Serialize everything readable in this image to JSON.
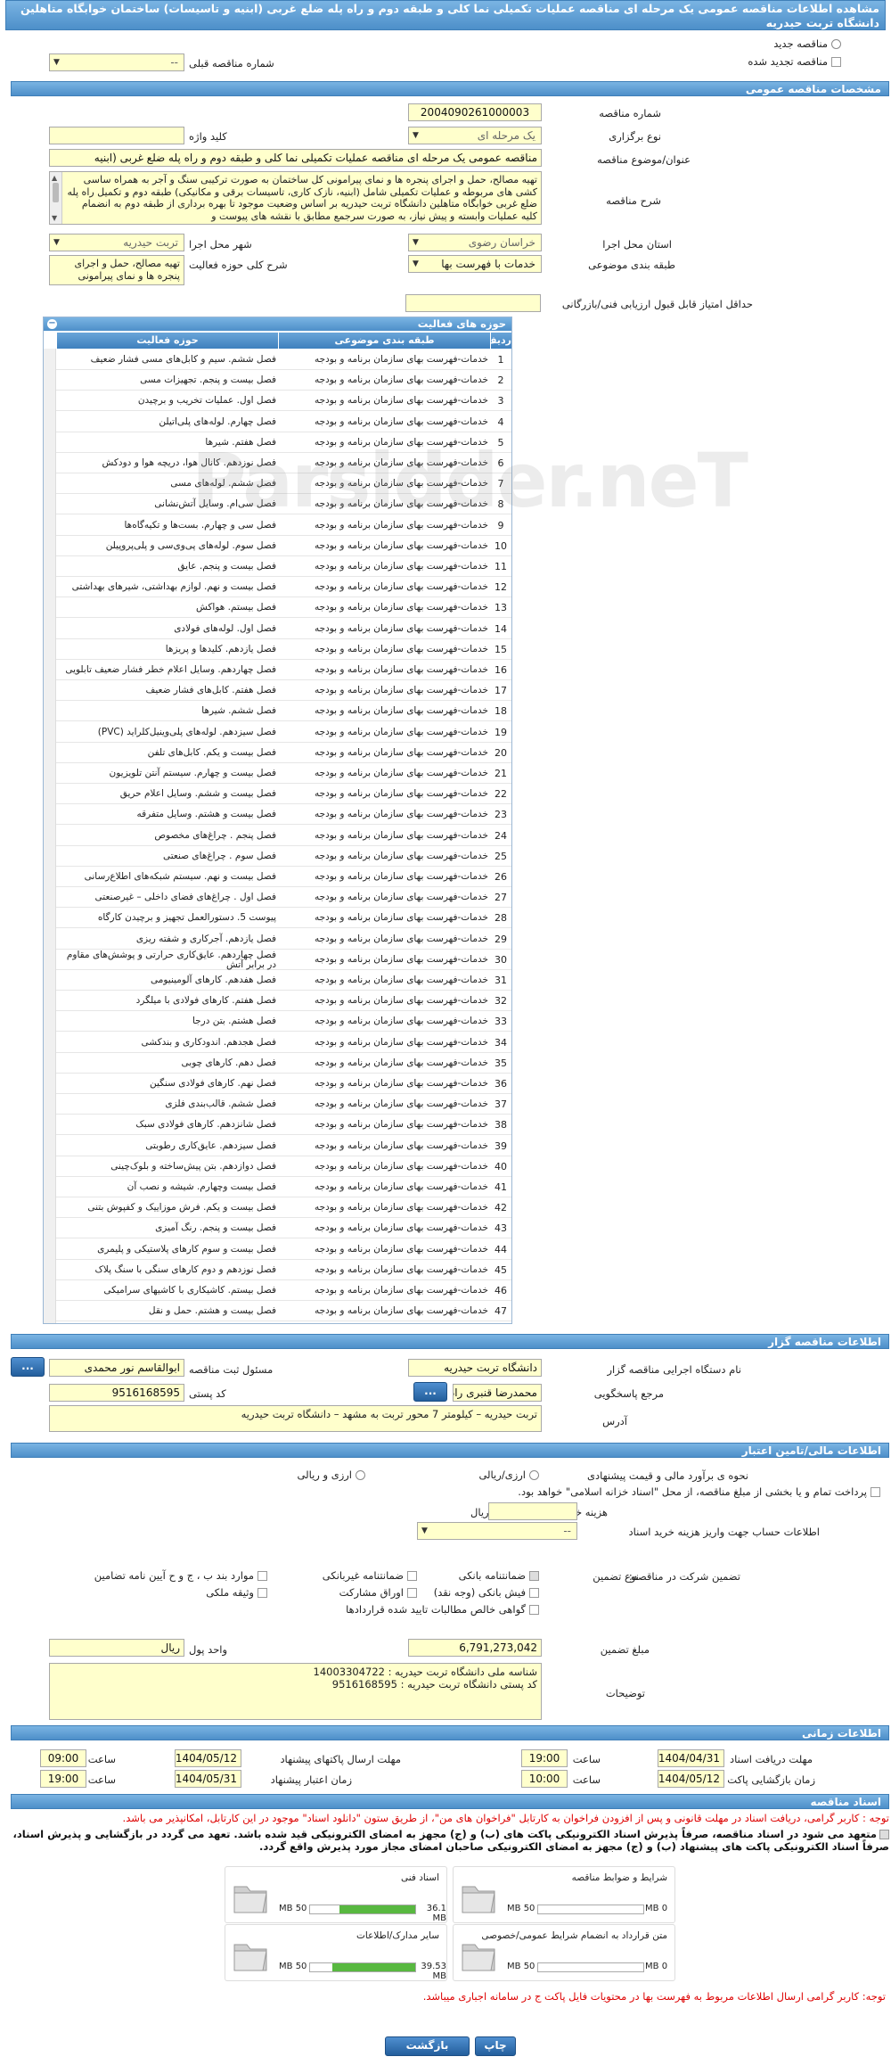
{
  "page_title": "مشاهده اطلاعات مناقصه عمومی یک مرحله ای مناقصه عملیات تکمیلی نما کلی و طبقه دوم و راه پله ضلع غربی (ابنیه و تاسیسات) ساختمان خوابگاه متاهلین دانشگاه تربت حیدریه",
  "top": {
    "new_tender": "مناقصه جدید",
    "renewed_tender": "مناقصه تجدید شده",
    "prev_tender_label": "شماره مناقصه قبلی",
    "prev_tender_value": "--"
  },
  "general": {
    "section_title": "مشخصات مناقصه عمومی",
    "tender_number_label": "شماره مناقصه",
    "tender_number": "2004090261000003",
    "type_label": "نوع برگزاری",
    "type_value": "یک مرحله ای",
    "keyword_label": "کلید واژه",
    "keyword_value": "",
    "subject_label": "عنوان/موضوع مناقصه",
    "subject_value": "مناقصه عمومی یک مرحله ای مناقصه عملیات تکمیلی نما کلی و طبقه دوم و راه پله ضلع غربی (ابنیه",
    "desc_label": "شرح مناقصه",
    "desc_value": "تهیه مصالح، حمل و اجرای پنجره ها و نمای پیرامونی کل ساختمان به صورت ترکیبی سنگ و آجر به همراه ساسی کشی های مربوطه و عملیات تکمیلی شامل (ابنیه، نازک کاری، تاسیسات برقی و مکانیکی) طبقه دوم و تکمیل راه پله ضلع غربی خوابگاه متاهلین دانشگاه تربت حیدریه بر اساس وضعیت موجود تا بهره برداری از طبقه دوم به انضمام کلیه عملیات وابسته و پیش نیاز، به صورت سرجمع مطابق با نقشه های پیوست و",
    "province_label": "استان محل اجرا",
    "province_value": "خراسان رضوی",
    "city_label": "شهر محل اجرا",
    "city_value": "تربت حیدریه",
    "category_label": "طبقه بندی موضوعی",
    "category_value": "خدمات با فهرست بها",
    "activity_desc_label": "شرح کلی حوزه فعالیت",
    "activity_desc_value": "تهیه مصالح، حمل و اجرای پنجره ها و نمای پیرامونی",
    "min_score_label": "حداقل امتیاز قابل قبول ارزیابی فنی/بازرگانی",
    "min_score_value": ""
  },
  "activities": {
    "title": "حوزه های فعالیت",
    "col_row": "ردیف",
    "col_category": "طبقه بندی موضوعی",
    "col_field": "حوزه فعالیت",
    "rows": [
      {
        "n": "1",
        "cat": "خدمات-فهرست بهای سازمان برنامه و بودجه",
        "field": "فصل ششم. سیم و کابل‌های مسی فشار ضعیف"
      },
      {
        "n": "2",
        "cat": "خدمات-فهرست بهای سازمان برنامه و بودجه",
        "field": "فصل بیست و پنجم. تجهیزات مسی"
      },
      {
        "n": "3",
        "cat": "خدمات-فهرست بهای سازمان برنامه و بودجه",
        "field": "فصل اول. عملیات تخریب و برچیدن"
      },
      {
        "n": "4",
        "cat": "خدمات-فهرست بهای سازمان برنامه و بودجه",
        "field": "فصل چهارم. لوله‌های پلی‌اتیلن"
      },
      {
        "n": "5",
        "cat": "خدمات-فهرست بهای سازمان برنامه و بودجه",
        "field": "فصل هفتم. شیرها"
      },
      {
        "n": "6",
        "cat": "خدمات-فهرست بهای سازمان برنامه و بودجه",
        "field": "فصل نوزدهم. کانال هوا، دریچه هوا و دودکش"
      },
      {
        "n": "7",
        "cat": "خدمات-فهرست بهای سازمان برنامه و بودجه",
        "field": "فصل ششم. لوله‌های مسی"
      },
      {
        "n": "8",
        "cat": "خدمات-فهرست بهای سازمان برنامه و بودجه",
        "field": "فصل سی‌ام. وسایل آتش‌نشانی"
      },
      {
        "n": "9",
        "cat": "خدمات-فهرست بهای سازمان برنامه و بودجه",
        "field": "فصل سی و چهارم. بست‌ها و تکیه‌گاه‌ها"
      },
      {
        "n": "10",
        "cat": "خدمات-فهرست بهای سازمان برنامه و بودجه",
        "field": "فصل سوم. لوله‌های پی‌وی‌سی و پلی‌پروپیلن"
      },
      {
        "n": "11",
        "cat": "خدمات-فهرست بهای سازمان برنامه و بودجه",
        "field": "فصل بیست و پنجم. عایق"
      },
      {
        "n": "12",
        "cat": "خدمات-فهرست بهای سازمان برنامه و بودجه",
        "field": "فصل بیست و نهم. لوازم بهداشتی، شیرهای بهداشتی"
      },
      {
        "n": "13",
        "cat": "خدمات-فهرست بهای سازمان برنامه و بودجه",
        "field": "فصل بیستم. هواکش"
      },
      {
        "n": "14",
        "cat": "خدمات-فهرست بهای سازمان برنامه و بودجه",
        "field": "فصل اول. لوله‌های فولادی"
      },
      {
        "n": "15",
        "cat": "خدمات-فهرست بهای سازمان برنامه و بودجه",
        "field": "فصل یازدهم. کلیدها و پریزها"
      },
      {
        "n": "16",
        "cat": "خدمات-فهرست بهای سازمان برنامه و بودجه",
        "field": "فصل چهاردهم. وسایل اعلام خطر فشار ضعیف تابلویی"
      },
      {
        "n": "17",
        "cat": "خدمات-فهرست بهای سازمان برنامه و بودجه",
        "field": "فصل هفتم. کابل‌های فشار ضعیف"
      },
      {
        "n": "18",
        "cat": "خدمات-فهرست بهای سازمان برنامه و بودجه",
        "field": "فصل ششم. شیرها"
      },
      {
        "n": "19",
        "cat": "خدمات-فهرست بهای سازمان برنامه و بودجه",
        "field": "فصل سیزدهم. لوله‌های پلی‌وینیل‌کلراید (PVC)"
      },
      {
        "n": "20",
        "cat": "خدمات-فهرست بهای سازمان برنامه و بودجه",
        "field": "فصل بیست و یکم. کابل‌های تلفن"
      },
      {
        "n": "21",
        "cat": "خدمات-فهرست بهای سازمان برنامه و بودجه",
        "field": "فصل بیست و چهارم. سیستم آنتن تلویزیون"
      },
      {
        "n": "22",
        "cat": "خدمات-فهرست بهای سازمان برنامه و بودجه",
        "field": "فصل بیست و ششم. وسایل اعلام حریق"
      },
      {
        "n": "23",
        "cat": "خدمات-فهرست بهای سازمان برنامه و بودجه",
        "field": "فصل بیست و هشتم. وسایل متفرقه"
      },
      {
        "n": "24",
        "cat": "خدمات-فهرست بهای سازمان برنامه و بودجه",
        "field": "فصل پنجم . چراغ‌های مخصوص"
      },
      {
        "n": "25",
        "cat": "خدمات-فهرست بهای سازمان برنامه و بودجه",
        "field": "فصل سوم . چراغ‌های صنعتی"
      },
      {
        "n": "26",
        "cat": "خدمات-فهرست بهای سازمان برنامه و بودجه",
        "field": "فصل بیست و نهم. سیستم شبکه‌های اطلاع‌رسانی"
      },
      {
        "n": "27",
        "cat": "خدمات-فهرست بهای سازمان برنامه و بودجه",
        "field": "فصل اول . چراغ‌های فضای داخلی – غیرصنعتی"
      },
      {
        "n": "28",
        "cat": "خدمات-فهرست بهای سازمان برنامه و بودجه",
        "field": "پیوست 5. دستورالعمل تجهیز و برچیدن کارگاه"
      },
      {
        "n": "29",
        "cat": "خدمات-فهرست بهای سازمان برنامه و بودجه",
        "field": "فصل یازدهم. آجرکاری و شفته ریزی"
      },
      {
        "n": "30",
        "cat": "خدمات-فهرست بهای سازمان برنامه و بودجه",
        "field": "فصل چهاردهم. عایق‌کاری حرارتی و پوشش‌های مقاوم در برابر آتش",
        "two": true
      },
      {
        "n": "31",
        "cat": "خدمات-فهرست بهای سازمان برنامه و بودجه",
        "field": "فصل هفدهم. کارهای آلومینیومی"
      },
      {
        "n": "32",
        "cat": "خدمات-فهرست بهای سازمان برنامه و بودجه",
        "field": "فصل هفتم. کارهای فولادی با میلگرد"
      },
      {
        "n": "33",
        "cat": "خدمات-فهرست بهای سازمان برنامه و بودجه",
        "field": "فصل هشتم. بتن درجا"
      },
      {
        "n": "34",
        "cat": "خدمات-فهرست بهای سازمان برنامه و بودجه",
        "field": "فصل هجدهم. اندودکاری و بندکشی"
      },
      {
        "n": "35",
        "cat": "خدمات-فهرست بهای سازمان برنامه و بودجه",
        "field": "فصل دهم. کارهای چوبی"
      },
      {
        "n": "36",
        "cat": "خدمات-فهرست بهای سازمان برنامه و بودجه",
        "field": "فصل نهم. کارهای فولادی سنگین"
      },
      {
        "n": "37",
        "cat": "خدمات-فهرست بهای سازمان برنامه و بودجه",
        "field": "فصل ششم. قالب‌بندی فلزی"
      },
      {
        "n": "38",
        "cat": "خدمات-فهرست بهای سازمان برنامه و بودجه",
        "field": "فصل شانزدهم. کارهای فولادی سبک"
      },
      {
        "n": "39",
        "cat": "خدمات-فهرست بهای سازمان برنامه و بودجه",
        "field": "فصل سیزدهم. عایق‌کاری رطوبتی"
      },
      {
        "n": "40",
        "cat": "خدمات-فهرست بهای سازمان برنامه و بودجه",
        "field": "فصل دوازدهم. بتن پیش‌ساخته و بلوک‌چینی"
      },
      {
        "n": "41",
        "cat": "خدمات-فهرست بهای سازمان برنامه و بودجه",
        "field": "فصل بیست وچهارم. شیشه و نصب آن"
      },
      {
        "n": "42",
        "cat": "خدمات-فهرست بهای سازمان برنامه و بودجه",
        "field": "فصل بیست و یکم. فرش موزاییک و کفپوش بتنی"
      },
      {
        "n": "43",
        "cat": "خدمات-فهرست بهای سازمان برنامه و بودجه",
        "field": "فصل بیست و پنجم. رنگ آمیزی"
      },
      {
        "n": "44",
        "cat": "خدمات-فهرست بهای سازمان برنامه و بودجه",
        "field": "فصل بیست و سوم کارهای پلاستیکی و پلیمری"
      },
      {
        "n": "45",
        "cat": "خدمات-فهرست بهای سازمان برنامه و بودجه",
        "field": "فصل نوزدهم و دوم کارهای سنگی با سنگ پلاک"
      },
      {
        "n": "46",
        "cat": "خدمات-فهرست بهای سازمان برنامه و بودجه",
        "field": "فصل بیستم. کاشیکاری با کاشیهای سرامیکی"
      },
      {
        "n": "47",
        "cat": "خدمات-فهرست بهای سازمان برنامه و بودجه",
        "field": "فصل بیست و هشتم. حمل و نقل"
      }
    ]
  },
  "organizer": {
    "section_title": "اطلاعات مناقصه گزار",
    "org_label": "نام دستگاه اجرایی مناقصه گزار",
    "org_value": "دانشگاه تربت حیدریه",
    "resp_label": "مسئول ثبت مناقصه",
    "resp_value": "ابوالقاسم نور محمدی",
    "answer_label": "مرجع پاسخگویی",
    "answer_value": "محمدرضا قنبری راد",
    "postal_label": "کد پستی",
    "postal_value": "9516168595",
    "address_label": "آدرس",
    "address_value": "تربت حیدریه – کیلومتر 7 محور تربت به مشهد – دانشگاه تربت حیدریه",
    "dots": "..."
  },
  "finance": {
    "section_title": "اطلاعات مالی/تامین اعتبار",
    "estimate_label": "نحوه ی برآورد مالی و قیمت پیشنهادی",
    "opt_rial": "ارزی/ریالی",
    "opt_fx": "ارزی و ریالی",
    "treasury_note": "پرداخت تمام و یا بخشی از مبلغ مناقصه، از محل \"اسناد خزانه اسلامی\" خواهد بود.",
    "doc_fee_label": "هزینه خرید اسناد",
    "doc_fee_value": "",
    "doc_fee_unit": "ریال",
    "account_label": "اطلاعات حساب جهت واریز هزینه خرید اسناد",
    "account_value": "--",
    "guarantee_label": "تضمین شرکت در مناقصه:",
    "guarantee_type_label": "نوع تضمین",
    "g1": "ضمانتنامه بانکی",
    "g2": "ضمانتنامه غیربانکی",
    "g3": "موارد بند ب ، ج و ح آیین نامه تضامین",
    "g4": "فیش بانکی (وجه نقد)",
    "g5": "اوراق مشارکت",
    "g6": "وثیقه ملکی",
    "g7": "گواهی خالص مطالبات تایید شده قراردادها",
    "amount_label": "مبلغ تضمین",
    "amount_value": "6,791,273,042",
    "currency_label": "واحد پول",
    "currency_value": "ریال",
    "notes_label": "توضیحات",
    "notes_line1": "شناسه ملی دانشگاه تربت حیدریه : 14003304722",
    "notes_line2": "کد پستی دانشگاه تربت حیدریه : 9516168595"
  },
  "timing": {
    "section_title": "اطلاعات زمانی",
    "receive_label": "مهلت دریافت اسناد",
    "receive_date": "1404/04/31",
    "receive_time": "19:00",
    "send_label": "مهلت ارسال پاکتهای پیشنهاد",
    "send_date": "1404/05/12",
    "send_time": "09:00",
    "open_label": "زمان بازگشایی پاکت ها",
    "open_date": "1404/05/12",
    "open_time": "10:00",
    "valid_label": "زمان اعتبار پیشنهاد",
    "valid_date": "1404/05/31",
    "valid_time": "19:00",
    "time_label": "ساعت"
  },
  "docs": {
    "section_title": "اسناد مناقصه",
    "note1": "توجه : کاربر گرامی، دریافت اسناد در مهلت قانونی و پس از افزودن فراخوان به کارتابل \"فراخوان های من\"، از طریق ستون \"دانلود اسناد\" موجود در این کارتابل، امکانپذیر می باشد.",
    "commit": "متعهد می شود در اسناد مناقصه، صرفاً پذیرش اسناد الکترونیکی پاکت های (ب) و (ج) مجهز به امضای الکترونیکی قید شده باشد. تعهد می گردد در بازگشایی و پذیرش اسناد، صرفاً اسناد الکترونیکی پاکت های پیشنهاد (ب) و (ج) مجهز به امضای الکترونیکی صاحبان امضای مجاز مورد پذیرش واقع گردد.",
    "items": [
      {
        "title": "شرایط و ضوابط مناقصه",
        "cur": "0 MB",
        "max": "50 MB",
        "pct": 0
      },
      {
        "title": "اسناد فنی",
        "cur": "36.1 MB",
        "max": "50 MB",
        "pct": 72
      },
      {
        "title": "متن قرارداد به انضمام شرایط عمومی/خصوصی",
        "cur": "0 MB",
        "max": "50 MB",
        "pct": 0
      },
      {
        "title": "سایر مدارک/اطلاعات",
        "cur": "39.53 MB",
        "max": "50 MB",
        "pct": 79
      }
    ],
    "note2": "توجه: کاربر گرامی ارسال اطلاعات مربوط به فهرست بها در محتویات فایل پاکت ج در سامانه اجباری میباشد."
  },
  "buttons": {
    "back": "بازگشت",
    "print": "چاپ"
  },
  "watermark": "Parsidder.neT"
}
